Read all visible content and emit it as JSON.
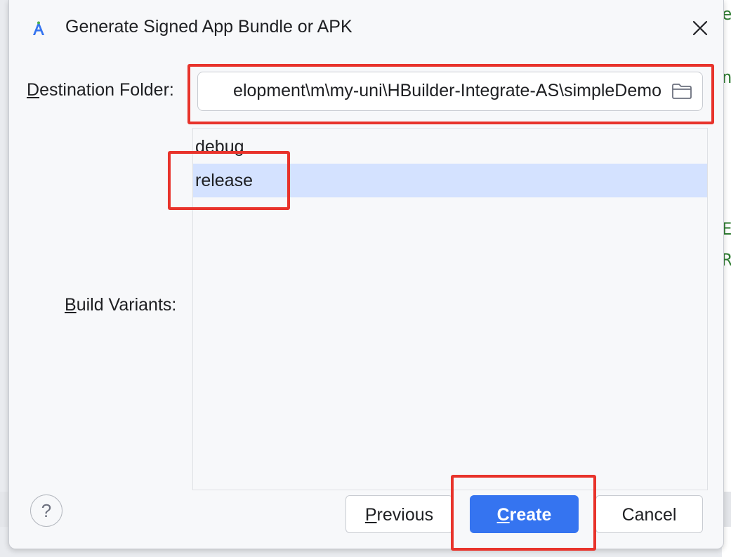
{
  "dialog": {
    "title": "Generate Signed App Bundle or APK",
    "title_icon": "android-studio-icon",
    "close_icon": "close-icon"
  },
  "destination": {
    "label_mnemonic": "D",
    "label_rest": "estination Folder:",
    "path": "elopment\\m\\my-uni\\HBuilder-Integrate-AS\\simpleDemo",
    "folder_icon": "folder-icon"
  },
  "build_variants": {
    "label_mnemonic": "B",
    "label_rest": "uild Variants:",
    "items": [
      {
        "label": "debug",
        "selected": false
      },
      {
        "label": "release",
        "selected": true
      }
    ],
    "selection_color": "#d4e2ff"
  },
  "footer": {
    "help_label": "?",
    "previous": {
      "mnemonic": "P",
      "rest": "revious"
    },
    "create": {
      "mnemonic": "C",
      "rest": "reate"
    },
    "cancel_label": "Cancel"
  },
  "background_fragments": [
    "e",
    "n",
    "E",
    "R"
  ],
  "colors": {
    "accent": "#3574f0",
    "annotation": "#e8332b"
  }
}
